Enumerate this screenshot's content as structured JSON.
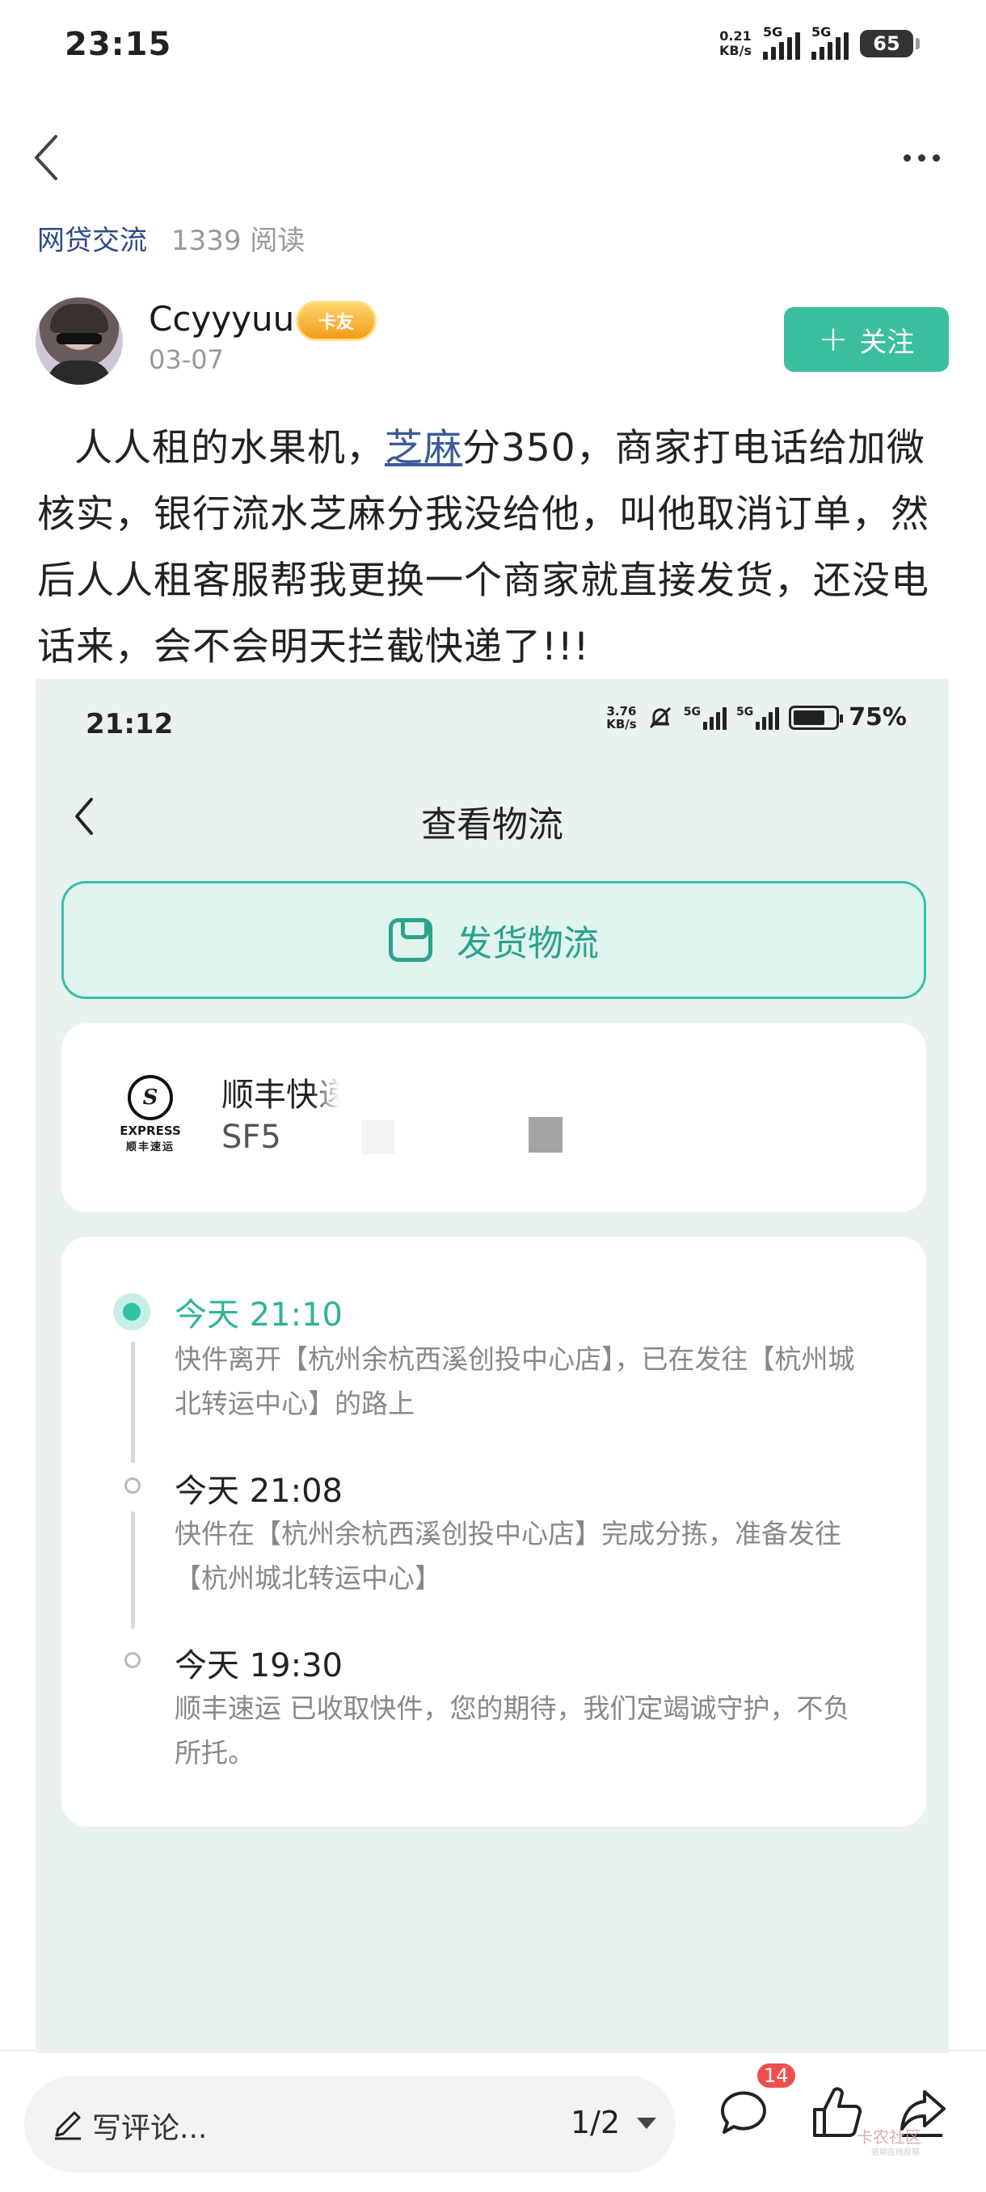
{
  "status_bar": {
    "time": "23:15",
    "net_speed_value": "0.21",
    "net_speed_unit": "KB/s",
    "sim1": "5G",
    "sim2": "5G",
    "battery": "65"
  },
  "post": {
    "category": "网贷交流",
    "reads": "1339 阅读",
    "author": "Ccyyyuu",
    "badge": "卡友",
    "date": "03-07",
    "follow_label": "关注",
    "text_before_link": "人人租的水果机，",
    "link_text": "芝麻",
    "text_after_link": "分350，商家打电话给加微核实，银行流水芝麻分我没给他，叫他取消订单，然后人人租客服帮我更换一个商家就直接发货，还没电话来，会不会明天拦截快递了!!!"
  },
  "screenshot": {
    "time": "21:12",
    "net_speed_value": "3.76",
    "net_speed_unit": "KB/s",
    "sim1": "5G",
    "sim2": "5G",
    "battery": "75%",
    "title": "查看物流",
    "tab_label": "发货物流",
    "carrier": {
      "name": "顺丰快递",
      "tracking_prefix": "SF5",
      "logo_express": "EXPRESS",
      "logo_cn": "顺丰速运"
    },
    "timeline": [
      {
        "time": "今天 21:10",
        "desc": "快件离开【杭州余杭西溪创投中心店】，已在发往【杭州城北转运中心】的路上",
        "active": true
      },
      {
        "time": "今天 21:08",
        "desc": "快件在【杭州余杭西溪创投中心店】完成分拣，准备发往【杭州城北转运中心】",
        "active": false
      },
      {
        "time": "今天 19:30",
        "desc": "顺丰速运 已收取快件，您的期待，我们定竭诚守护，不负所托。",
        "active": false
      }
    ]
  },
  "bottom_bar": {
    "comment_placeholder": "写评论...",
    "page_indicator": "1/2",
    "comment_count": "14",
    "watermark": "卡农社区",
    "watermark_sub": "逾期在线投稿"
  },
  "colors": {
    "accent": "#3bbf9f",
    "link": "#3a5a9a",
    "category": "#2b4a8a",
    "badge_red": "#f04e4e"
  },
  "icons": [
    "back-chevron-icon",
    "more-dots-icon",
    "plus-icon",
    "package-icon",
    "sf-express-logo",
    "pencil-icon",
    "caret-down-icon",
    "comment-bubble-icon",
    "thumbs-up-icon",
    "share-icon",
    "bell-off-icon"
  ]
}
